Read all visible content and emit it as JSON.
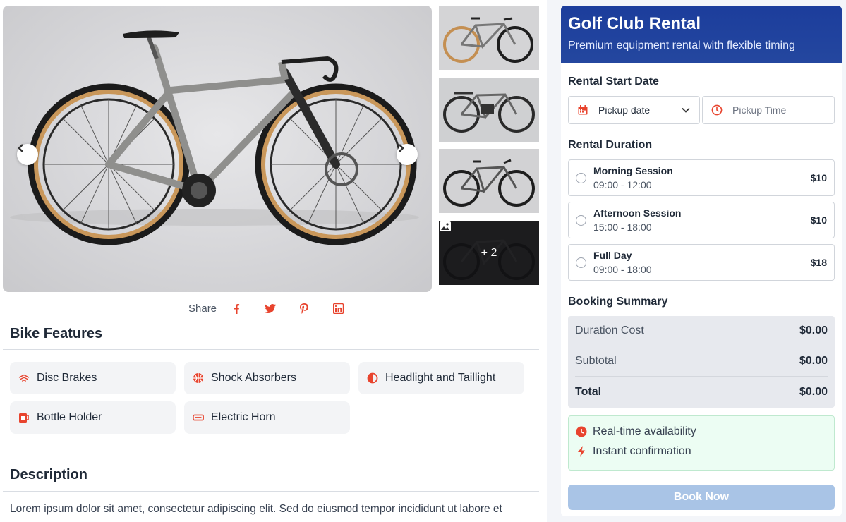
{
  "gallery": {
    "prev_icon": "chevron-left-icon",
    "next_icon": "chevron-right-icon",
    "more_count": "+ 2",
    "more_icon": "image-icon"
  },
  "share": {
    "label": "Share",
    "networks": [
      "facebook-icon",
      "twitter-icon",
      "pinterest-icon",
      "linkedin-icon"
    ],
    "accent": "#e8442e"
  },
  "features": {
    "title": "Bike Features",
    "items": [
      {
        "label": "Disc Brakes",
        "icon": "disc-brakes-icon"
      },
      {
        "label": "Shock Absorbers",
        "icon": "shock-icon"
      },
      {
        "label": "Headlight and Taillight",
        "icon": "light-icon"
      },
      {
        "label": "Bottle Holder",
        "icon": "bottle-icon"
      },
      {
        "label": "Electric Horn",
        "icon": "horn-icon"
      }
    ]
  },
  "description": {
    "title": "Description",
    "text": "Lorem ipsum dolor sit amet, consectetur adipiscing elit. Sed do eiusmod tempor incididunt ut labore et"
  },
  "panel": {
    "title": "Golf Club Rental",
    "subtitle": "Premium equipment rental with flexible timing",
    "start_label": "Rental Start Date",
    "pickup_date": "Pickup date",
    "pickup_time_placeholder": "Pickup Time",
    "duration_label": "Rental Duration",
    "options": [
      {
        "name": "Morning Session",
        "time": "09:00 - 12:00",
        "price": "$10"
      },
      {
        "name": "Afternoon Session",
        "time": "15:00 - 18:00",
        "price": "$10"
      },
      {
        "name": "Full Day",
        "time": "09:00 - 18:00",
        "price": "$18"
      }
    ],
    "summary_label": "Booking Summary",
    "summary": [
      {
        "label": "Duration Cost",
        "value": "$0.00"
      },
      {
        "label": "Subtotal",
        "value": "$0.00"
      },
      {
        "label": "Total",
        "value": "$0.00"
      }
    ],
    "info": [
      "Real-time availability",
      "Instant confirmation"
    ],
    "book_label": "Book Now",
    "header_color": "#1c3d9c",
    "button_color": "#a9c4e6"
  }
}
